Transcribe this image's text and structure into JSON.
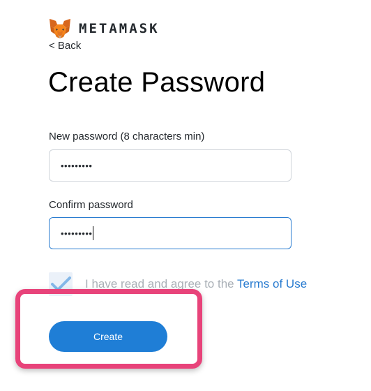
{
  "header": {
    "brand": "METAMASK",
    "logo_icon": "fox-logo-icon",
    "back_label": "< Back"
  },
  "page": {
    "title": "Create Password"
  },
  "form": {
    "new_password": {
      "label": "New password (8 characters min)",
      "value_masked": "•••••••••"
    },
    "confirm_password": {
      "label": "Confirm password",
      "value_masked": "•••••••••"
    },
    "agree": {
      "checked": true,
      "text": "I have read and agree to the",
      "link_text": "Terms of Use"
    },
    "create_label": "Create"
  },
  "colors": {
    "accent": "#1f7ed6",
    "link": "#2a7cd0",
    "highlight": "#e8437a"
  }
}
